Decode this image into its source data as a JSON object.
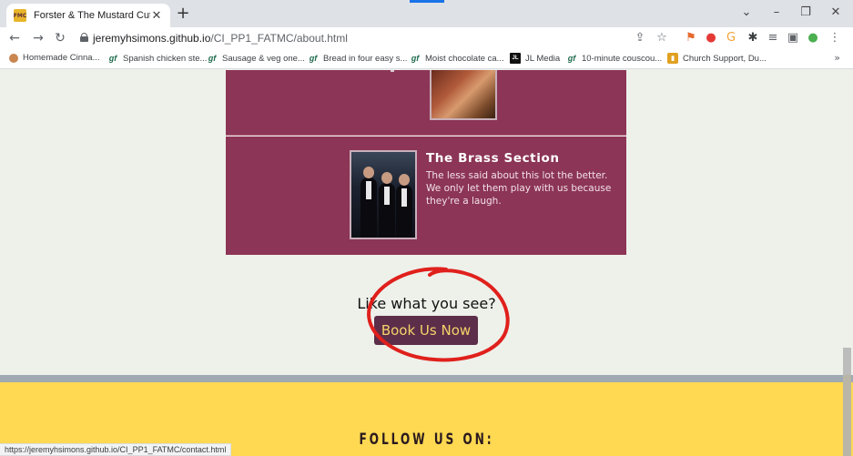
{
  "browser": {
    "tab_title": "Forster & The Mustard Cutters",
    "favicon_text": "FMC",
    "url_domain": "jeremyhsimons.github.io",
    "url_path": "/CI_PP1_FATMC/about.html",
    "status_url": "https://jeremyhsimons.github.io/CI_PP1_FATMC/contact.html"
  },
  "bookmarks": [
    {
      "label": "Homemade Cinna...",
      "icon": "cinnamon-icon"
    },
    {
      "label": "Spanish chicken ste...",
      "icon": "gf-icon"
    },
    {
      "label": "Sausage & veg one...",
      "icon": "gf-icon"
    },
    {
      "label": "Bread in four easy s...",
      "icon": "gf-icon"
    },
    {
      "label": "Moist chocolate ca...",
      "icon": "gf-icon"
    },
    {
      "label": "JL Media",
      "icon": "jl-icon"
    },
    {
      "label": "10-minute couscou...",
      "icon": "gf-icon"
    },
    {
      "label": "Church Support, Du...",
      "icon": "church-icon"
    }
  ],
  "band": {
    "title": "The Brass Section",
    "description": "The less said about this lot the better. We only let them play with us because they're a laugh."
  },
  "cta": {
    "prompt": "Like what you see?",
    "button_label": "Book Us Now"
  },
  "footer": {
    "heading": "FOLLOW US ON:"
  },
  "colors": {
    "card": "#8c3556",
    "button": "#5c2e49",
    "button_text": "#f5d36a",
    "footer": "#ffd951",
    "annotation": "#e0201c"
  }
}
